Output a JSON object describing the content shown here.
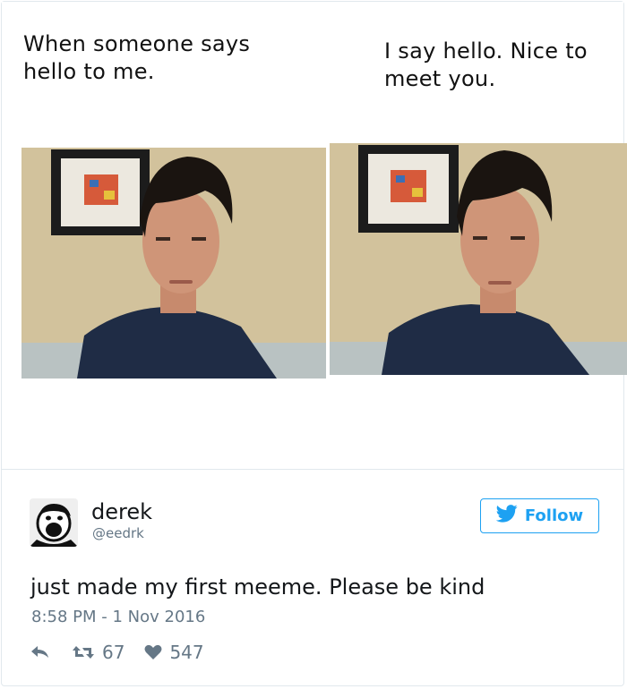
{
  "meme": {
    "caption_left": "When someone says hello to me.",
    "caption_right": "I say hello. Nice to meet you."
  },
  "author": {
    "name": "derek",
    "handle": "@eedrk"
  },
  "follow_label": "Follow",
  "tweet": {
    "text": "just made my first meeme. Please be kind",
    "timestamp": "8:58 PM - 1 Nov 2016"
  },
  "stats": {
    "retweets": "67",
    "likes": "547"
  },
  "colors": {
    "accent": "#1da1f2",
    "muted": "#657786",
    "wall": "#d8c9a6",
    "shirt": "#1f2c45"
  },
  "icons": [
    "reply-icon",
    "retweet-icon",
    "heart-icon",
    "twitter-bird-icon"
  ]
}
